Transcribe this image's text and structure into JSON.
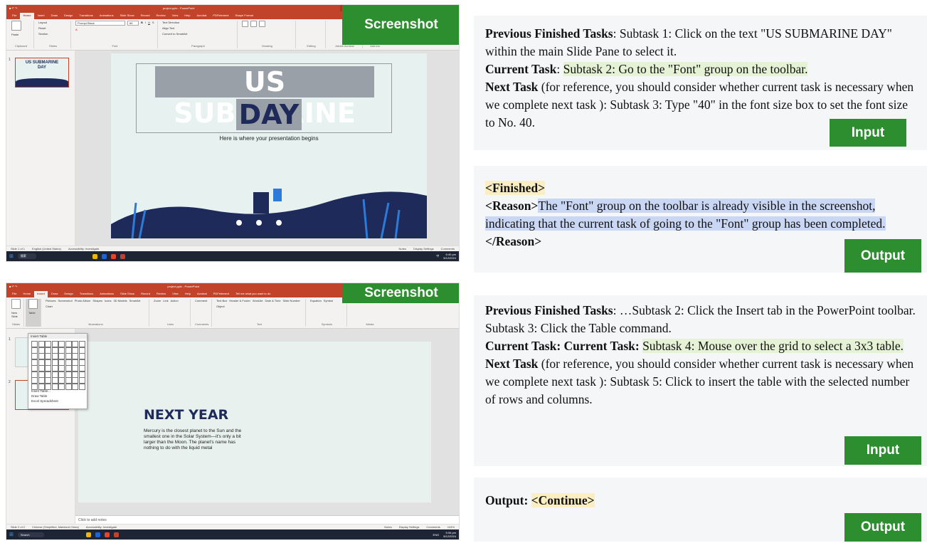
{
  "colors": {
    "accent_green": "#2c8e2e",
    "ppt_red": "#c0432a",
    "highlight_green": "#e6f2d6",
    "highlight_yellow": "#fbeec3",
    "highlight_blue": "#c9d7f5",
    "slide_navy": "#1e2a5a"
  },
  "labels": {
    "screenshot": "Screenshot",
    "input": "Input",
    "output": "Output"
  },
  "example1": {
    "window_title": "project.pptx - PowerPoint",
    "context_tab": "Drawing Tools",
    "tabs": [
      "File",
      "Home",
      "Insert",
      "Draw",
      "Design",
      "Transitions",
      "Animations",
      "Slide Show",
      "Record",
      "Review",
      "View",
      "Help",
      "Acrobat",
      "PDFelement",
      "Shape Format"
    ],
    "active_tab": "Home",
    "tell_me": "Tell me what you want to do",
    "groups": {
      "clipboard": "Clipboard",
      "slides": "Slides",
      "font": "Font",
      "paragraph": "Paragraph",
      "drawing": "Drawing",
      "editing": "Editing",
      "adobe": "Adobe Acrobat",
      "addins": "Add-ins"
    },
    "slides_items": [
      "Layout",
      "Reset",
      "Section"
    ],
    "paste": "Paste",
    "new_slide": "New Slide",
    "font_name": "Prompt Black",
    "font_size": "66",
    "para_items": [
      "Text Direction",
      "Align Text",
      "Convert to SmartArt"
    ],
    "slide_title_line1": "US SUBMARINE",
    "slide_title_line2": "DAY",
    "slide_subtitle": "Here is where your presentation begins",
    "thumb_title": "US SUBMARINE DAY",
    "thumb_num": "1",
    "status_slide": "Slide 1 of 1",
    "status_lang": "English (United States)",
    "status_access": "Accessibility: Investigate",
    "status_notes": "Notes",
    "status_display": "Display Settings",
    "status_comments": "Comments",
    "search": "搜索",
    "time": "6:40 pm",
    "date": "5/12/2024",
    "tray": "中"
  },
  "example2": {
    "window_title": "project.pptx - PowerPoint",
    "tabs": [
      "File",
      "Home",
      "Insert",
      "Draw",
      "Design",
      "Transitions",
      "Animations",
      "Slide Show",
      "Record",
      "Review",
      "View",
      "Help",
      "Acrobat",
      "PDFelement",
      "Tell me what you want to do"
    ],
    "active_tab": "Insert",
    "ribbon_items": [
      "New Slide",
      "Table",
      "Pictures",
      "Screenshot",
      "Photo Album",
      "Shapes",
      "Icons",
      "3D Models",
      "SmartArt",
      "Chart",
      "Zoom",
      "Link",
      "Action",
      "Comment",
      "Text Box",
      "Header & Footer",
      "WordArt",
      "Date & Time",
      "Slide Number",
      "Object",
      "Equation",
      "Symbol"
    ],
    "groups": {
      "slides": "Slides",
      "illustrations": "Illustrations",
      "links": "Links",
      "comments": "Comments",
      "text": "Text",
      "symbols": "Symbols",
      "media": "Media"
    },
    "recording": "Recording",
    "table_menu_header": "Insert Table",
    "table_menu_items": [
      "Insert Table...",
      "Draw Table",
      "Excel Spreadsheet"
    ],
    "slide_heading": "NEXT YEAR",
    "slide_body": "Mercury is the closest planet to the Sun and the smallest one in the Solar System—it's only a bit larger than the Moon. The planet's name has nothing to do with the liquid metal",
    "notes": "Click to add notes",
    "thumb_nums": [
      "1",
      "2"
    ],
    "status_slide": "Slide 2 of 2",
    "status_lang": "Chinese (Simplified, Mainland China)",
    "status_access": "Accessibility: Investigate",
    "status_notes": "Notes",
    "status_display": "Display Settings",
    "status_comments": "Comments",
    "zoom": "104%",
    "search": "Search",
    "time": "5:06 pm",
    "date": "5/12/2024",
    "tray": "ENG"
  },
  "text1": {
    "prev_label": "Previous Finished Tasks",
    "prev": ": Subtask 1: Click on the text \"US SUBMARINE DAY\" within the main Slide Pane to select it.",
    "cur_label": "Current Task",
    "cur_sep": ": ",
    "cur": "Subtask 2: Go to the \"Font\" group on the toolbar.",
    "next_label": "Next Task",
    "next": " (for reference, you should consider whether current task is necessary when we complete next task ): Subtask 3: Type \"40\" in the font size box to set the font size to No. 40."
  },
  "output1": {
    "finished": "<Finished>",
    "reason_open": "<Reason>",
    "reason": "The \"Font\" group on the toolbar is already visible in the screenshot, indicating that the current task of going to the \"Font\" group has been completed.",
    "reason_close": "</Reason>"
  },
  "text2": {
    "prev_label": "Previous Finished Tasks",
    "prev": ": …Subtask 2: Click the Insert tab in the PowerPoint toolbar. Subtask 3: Click the Table command.",
    "cur_label": "Current Task: Current Task:",
    "cur": "Subtask 4: Mouse over the grid to select a 3x3 table.",
    "next_label": "Next Task",
    "next": " (for reference, you should consider whether current task is necessary when we complete next task ): Subtask 5: Click to insert the table with the selected number of rows and columns."
  },
  "output2": {
    "label": "Output: ",
    "value": "<Continue>"
  }
}
